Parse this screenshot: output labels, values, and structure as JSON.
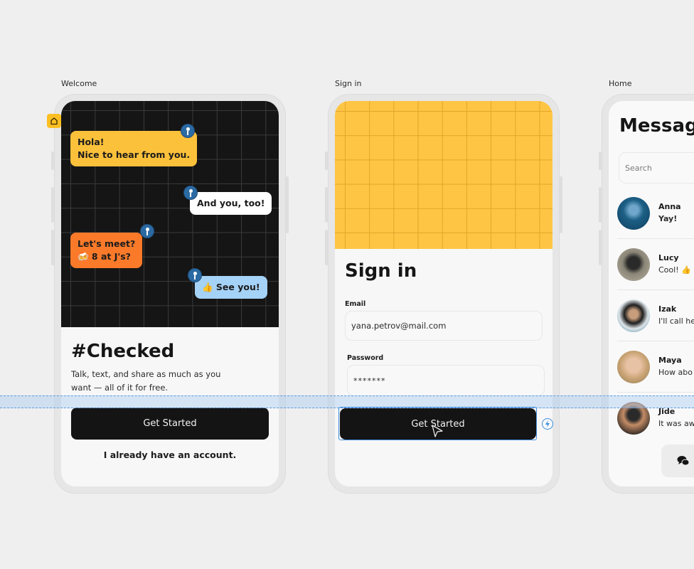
{
  "frames": [
    {
      "label": "Welcome"
    },
    {
      "label": "Sign in"
    },
    {
      "label": "Home"
    }
  ],
  "welcome": {
    "bubbles": [
      {
        "line1": "Hola!",
        "line2": "Nice to hear from you.",
        "color": "#fcc13b"
      },
      {
        "line1": "And you, too!",
        "color": "#ffffff"
      },
      {
        "line1": "Let's meet?",
        "line2": "🍻 8 at J's?",
        "color": "#fa7a2a"
      },
      {
        "line1": "👍 See you!",
        "color": "#a5d2f7"
      }
    ],
    "title": "#Checked",
    "description_line1": "Talk, text, and share as much as you",
    "description_line2": "want — all of it for free.",
    "primary_button": "Get Started",
    "secondary_link": "I already have an account."
  },
  "signin": {
    "title": "Sign in",
    "email_label": "Email",
    "email_value": "yana.petrov@mail.com",
    "password_label": "Password",
    "password_value": "*******",
    "primary_button": "Get Started"
  },
  "home": {
    "title": "Messages",
    "search_placeholder": "Search",
    "chats": [
      {
        "name": "Anna",
        "message": "Yay!",
        "avatar_color": "#1d5f86"
      },
      {
        "name": "Lucy",
        "message": "Cool! 👍",
        "avatar_color": "#6f6a5e"
      },
      {
        "name": "Izak",
        "message": "I'll call he",
        "avatar_color": "#3b4a55"
      },
      {
        "name": "Maya",
        "message": "How abo",
        "avatar_color": "#c9a374"
      },
      {
        "name": "Jide",
        "message": "It was aw",
        "avatar_color": "#b77a52"
      }
    ]
  },
  "colors": {
    "accent_yellow": "#fec544",
    "dark": "#141414",
    "selection_blue": "#3d8ce0"
  }
}
